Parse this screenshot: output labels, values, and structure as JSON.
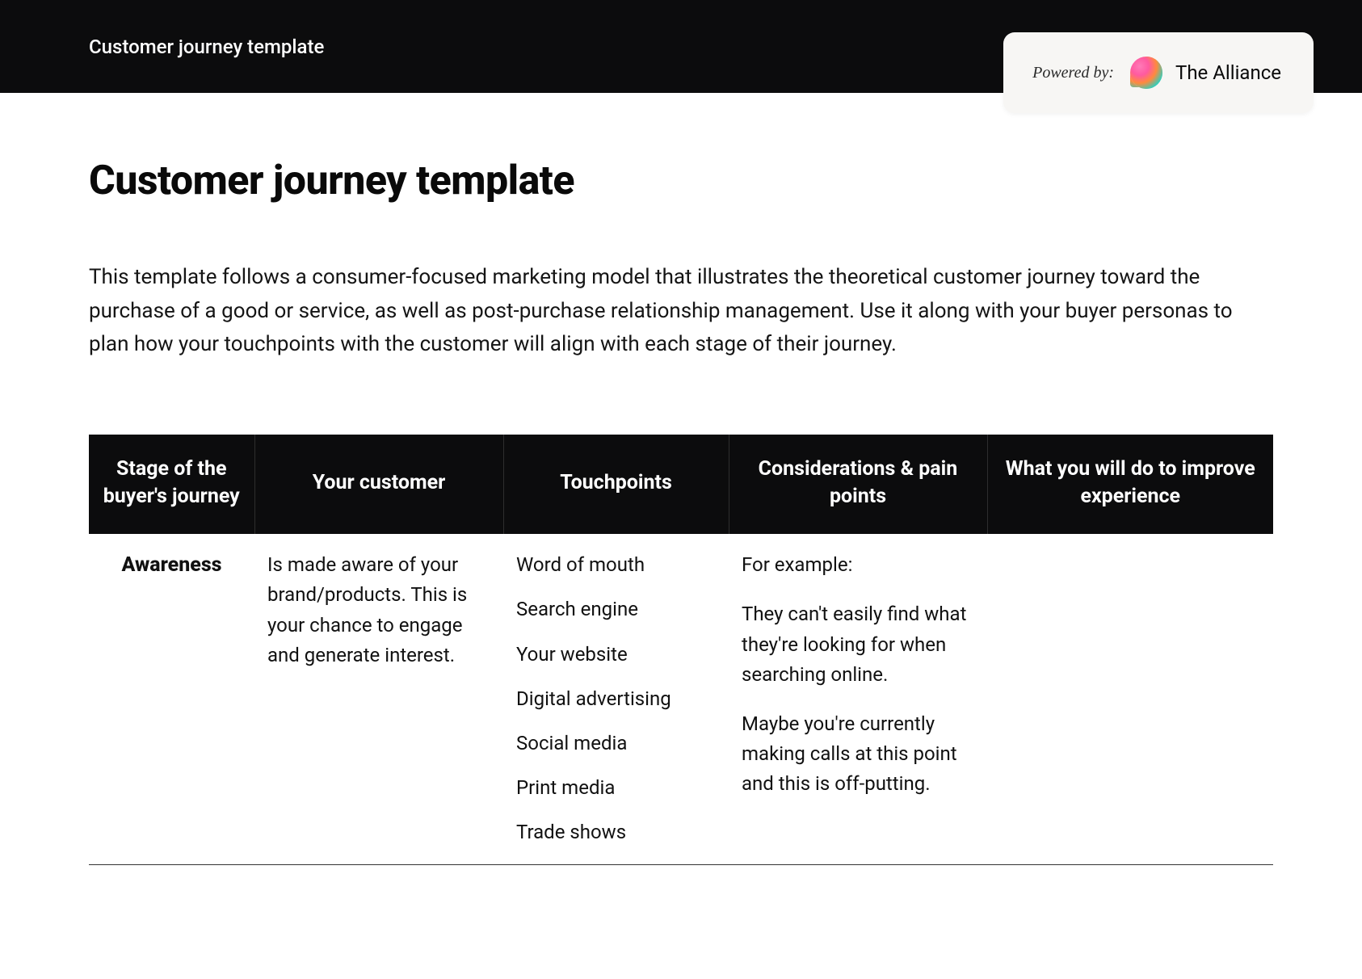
{
  "topbar": {
    "title": "Customer journey template"
  },
  "powered": {
    "label": "Powered by:",
    "brand": "The Alliance"
  },
  "page": {
    "heading": "Customer journey template",
    "intro": "This template follows a consumer-focused marketing model that illustrates the theoretical customer journey toward the purchase of a good or service, as well as post-purchase relationship management. Use it along with your buyer personas to plan how your touchpoints with the customer will align with each stage of their journey."
  },
  "table": {
    "headers": {
      "stage": "Stage of the buyer's journey",
      "customer": "Your customer",
      "touchpoints": "Touchpoints",
      "considerations": "Considerations & pain points",
      "improve": "What you will do to improve experience"
    },
    "rows": [
      {
        "stage": "Awareness",
        "customer": "Is made aware of your brand/products. This is your chance to engage and generate interest.",
        "touchpoints": [
          "Word of mouth",
          "Search engine",
          "Your website",
          "Digital advertising",
          "Social media",
          "Print media",
          "Trade shows"
        ],
        "considerations": {
          "lead": "For example:",
          "p1": "They can't easily find what they're looking for when searching online.",
          "p2": "Maybe you're currently making calls at this point and this is off-putting."
        },
        "improve": ""
      }
    ]
  }
}
